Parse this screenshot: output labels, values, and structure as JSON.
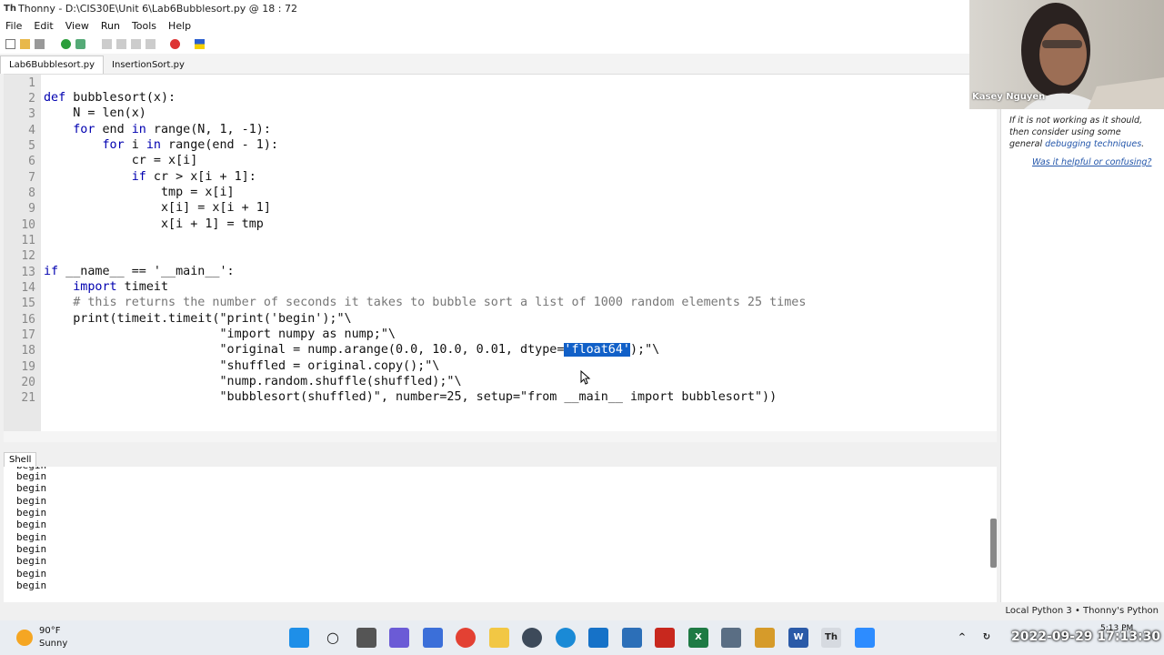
{
  "window": {
    "title": "Thonny  -  D:\\CIS30E\\Unit 6\\Lab6Bubblesort.py  @  18 : 72"
  },
  "menu": [
    "File",
    "Edit",
    "View",
    "Run",
    "Tools",
    "Help"
  ],
  "tabs": [
    "Lab6Bubblesort.py",
    "InsertionSort.py"
  ],
  "editor": {
    "line_numbers": [
      "1",
      "2",
      "3",
      "4",
      "5",
      "6",
      "7",
      "8",
      "9",
      "10",
      "11",
      "12",
      "13",
      "14",
      "15",
      "16",
      "17",
      "18",
      "19",
      "20",
      "21"
    ],
    "lines": [
      "",
      "def bubblesort(x):",
      "    N = len(x)",
      "    for end in range(N, 1, -1):",
      "        for i in range(end - 1):",
      "            cr = x[i]",
      "            if cr > x[i + 1]:",
      "                tmp = x[i]",
      "                x[i] = x[i + 1]",
      "                x[i + 1] = tmp",
      "",
      "",
      "if __name__ == '__main__':",
      "    import timeit",
      "    # this returns the number of seconds it takes to bubble sort a list of 1000 random elements 25 times",
      "    print(timeit.timeit(\"print('begin');\"\\",
      "                        \"import numpy as nump;\"\\",
      "                        \"original = nump.arange(0.0, 10.0, 0.01, dtype='float64');\"\\",
      "                        \"shuffled = original.copy();\"\\",
      "                        \"nump.random.shuffle(shuffled);\"\\",
      "                        \"bubblesort(shuffled)\", number=25, setup=\"from __main__ import bubblesort\"))"
    ],
    "line18_pre": "                        \"original = nump.arange(0.0, 10.0, 0.01, dtype=",
    "line18_sel": "'float64'",
    "line18_post": ");\"\\"
  },
  "shell": {
    "tab_label": "Shell",
    "lines": [
      "begin",
      "begin",
      "begin",
      "begin",
      "begin",
      "begin",
      "begin",
      "begin",
      "begin",
      "begin",
      "begin"
    ]
  },
  "assistant": {
    "text": "If it is not working as it should, then consider using some general ",
    "link": "debugging techniques",
    "text_end": ".",
    "feedback": "Was it helpful or confusing?"
  },
  "statusbar": {
    "text": "Local Python 3  •  Thonny's Python"
  },
  "webcam": {
    "name": "Kasey Nguyen"
  },
  "taskbar": {
    "weather_temp": "90°F",
    "weather_desc": "Sunny",
    "clock_overlay": "2022-09-29 17:13:30",
    "clock_time": "5:13 PM"
  }
}
